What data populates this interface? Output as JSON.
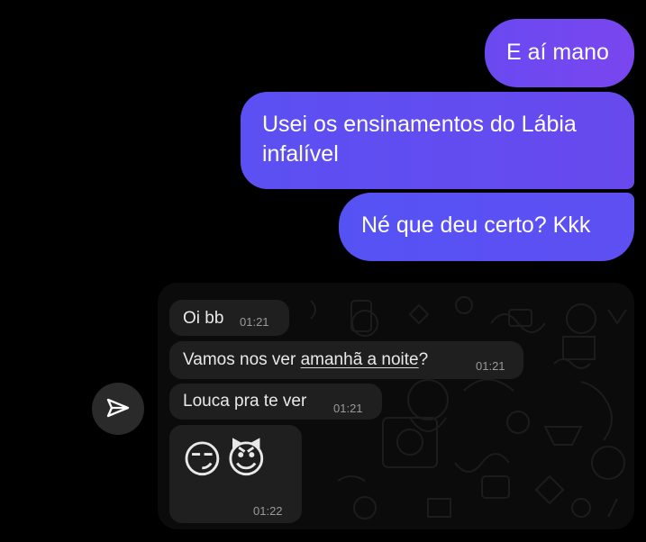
{
  "messages": [
    {
      "text": "E aí mano"
    },
    {
      "text": "Usei os ensinamentos do Lábia infalível"
    },
    {
      "text": "Né que deu certo? Kkk"
    }
  ],
  "shared_chat": {
    "messages": [
      {
        "text": "Oi bb",
        "time": "01:21"
      },
      {
        "prefix": "Vamos nos ver ",
        "underlined": "amanhã a noite",
        "suffix": "?",
        "time": "01:21"
      },
      {
        "text": "Louca pra te ver",
        "time": "01:21"
      },
      {
        "emoji": "😏😈",
        "time": "01:22"
      }
    ]
  },
  "icons": {
    "send": "send-paper-plane-icon"
  },
  "colors": {
    "bubble_top": "#7a46ef",
    "bubble_bottom": "#5552f4",
    "shared_bubble": "#1f1f1f",
    "background": "#000000"
  }
}
